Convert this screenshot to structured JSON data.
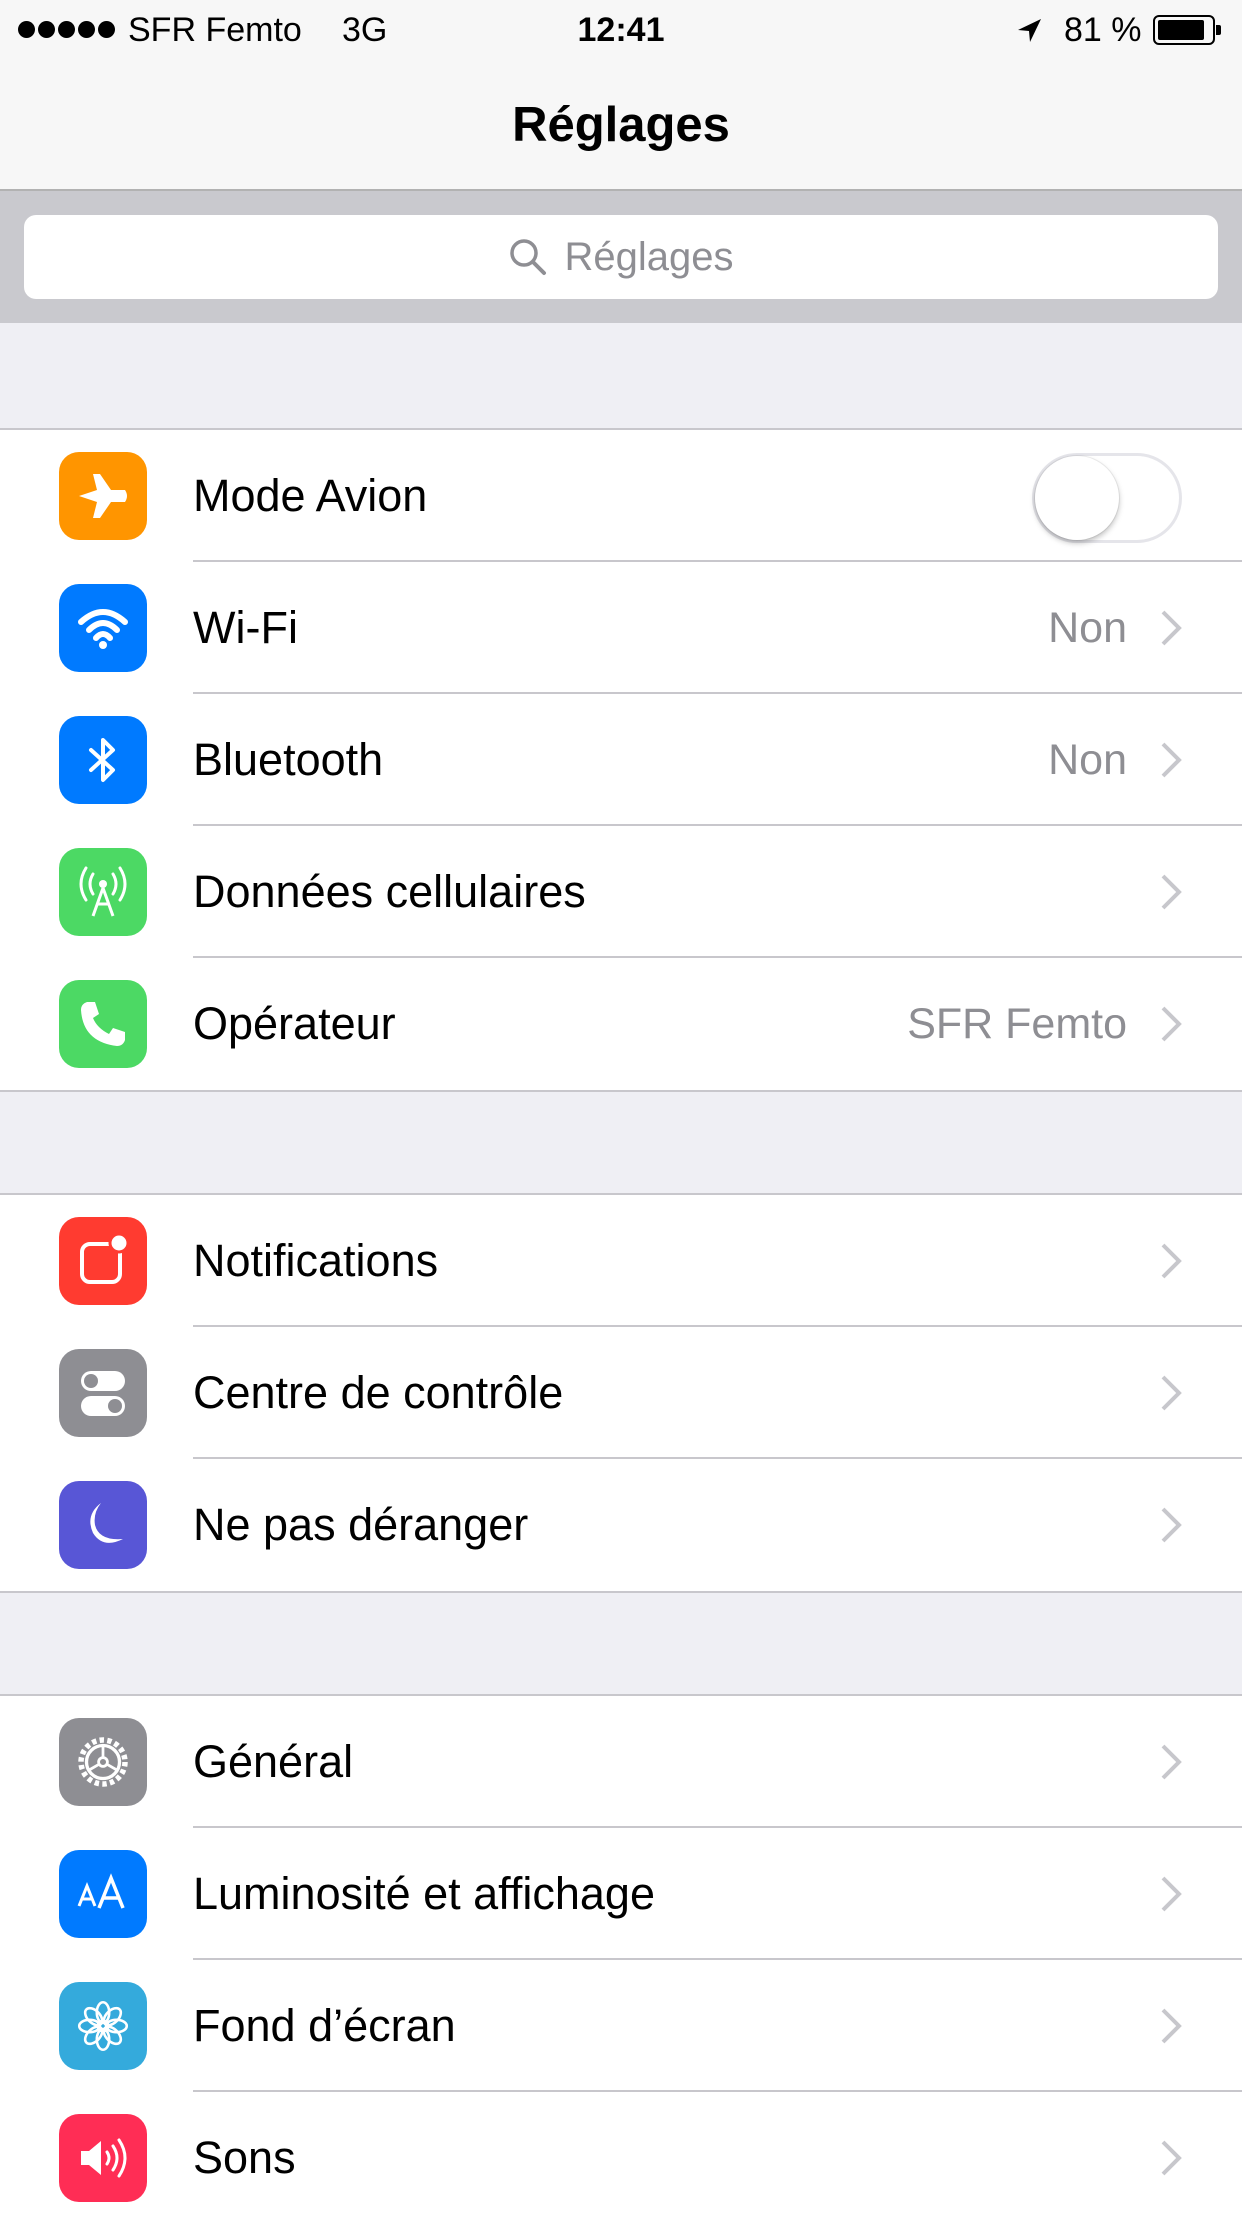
{
  "status_bar": {
    "carrier": "SFR Femto",
    "network": "3G",
    "time": "12:41",
    "battery_percent": "81 %",
    "battery_level": 0.81
  },
  "nav": {
    "title": "Réglages"
  },
  "search": {
    "placeholder": "Réglages"
  },
  "colors": {
    "orange": "#ff9500",
    "blue": "#007aff",
    "green": "#4cd964",
    "red": "#ff3b30",
    "gray": "#8e8e93",
    "indigo": "#5856d6",
    "teal": "#34aadc",
    "pink": "#ff2d55"
  },
  "groups": [
    {
      "rows": [
        {
          "label": "Mode Avion",
          "icon": "airplane-icon",
          "control": "toggle",
          "toggle_on": false
        },
        {
          "label": "Wi-Fi",
          "icon": "wifi-icon",
          "value": "Non"
        },
        {
          "label": "Bluetooth",
          "icon": "bluetooth-icon",
          "value": "Non"
        },
        {
          "label": "Données cellulaires",
          "icon": "cellular-antenna-icon"
        },
        {
          "label": "Opérateur",
          "icon": "phone-icon",
          "value": "SFR Femto"
        }
      ]
    },
    {
      "rows": [
        {
          "label": "Notifications",
          "icon": "notifications-icon"
        },
        {
          "label": "Centre de contrôle",
          "icon": "control-center-icon"
        },
        {
          "label": "Ne pas déranger",
          "icon": "moon-icon"
        }
      ]
    },
    {
      "rows": [
        {
          "label": "Général",
          "icon": "gear-icon"
        },
        {
          "label": "Luminosité et affichage",
          "icon": "display-text-size-icon"
        },
        {
          "label": "Fond d’écran",
          "icon": "wallpaper-flower-icon"
        },
        {
          "label": "Sons",
          "icon": "speaker-icon"
        }
      ]
    }
  ]
}
